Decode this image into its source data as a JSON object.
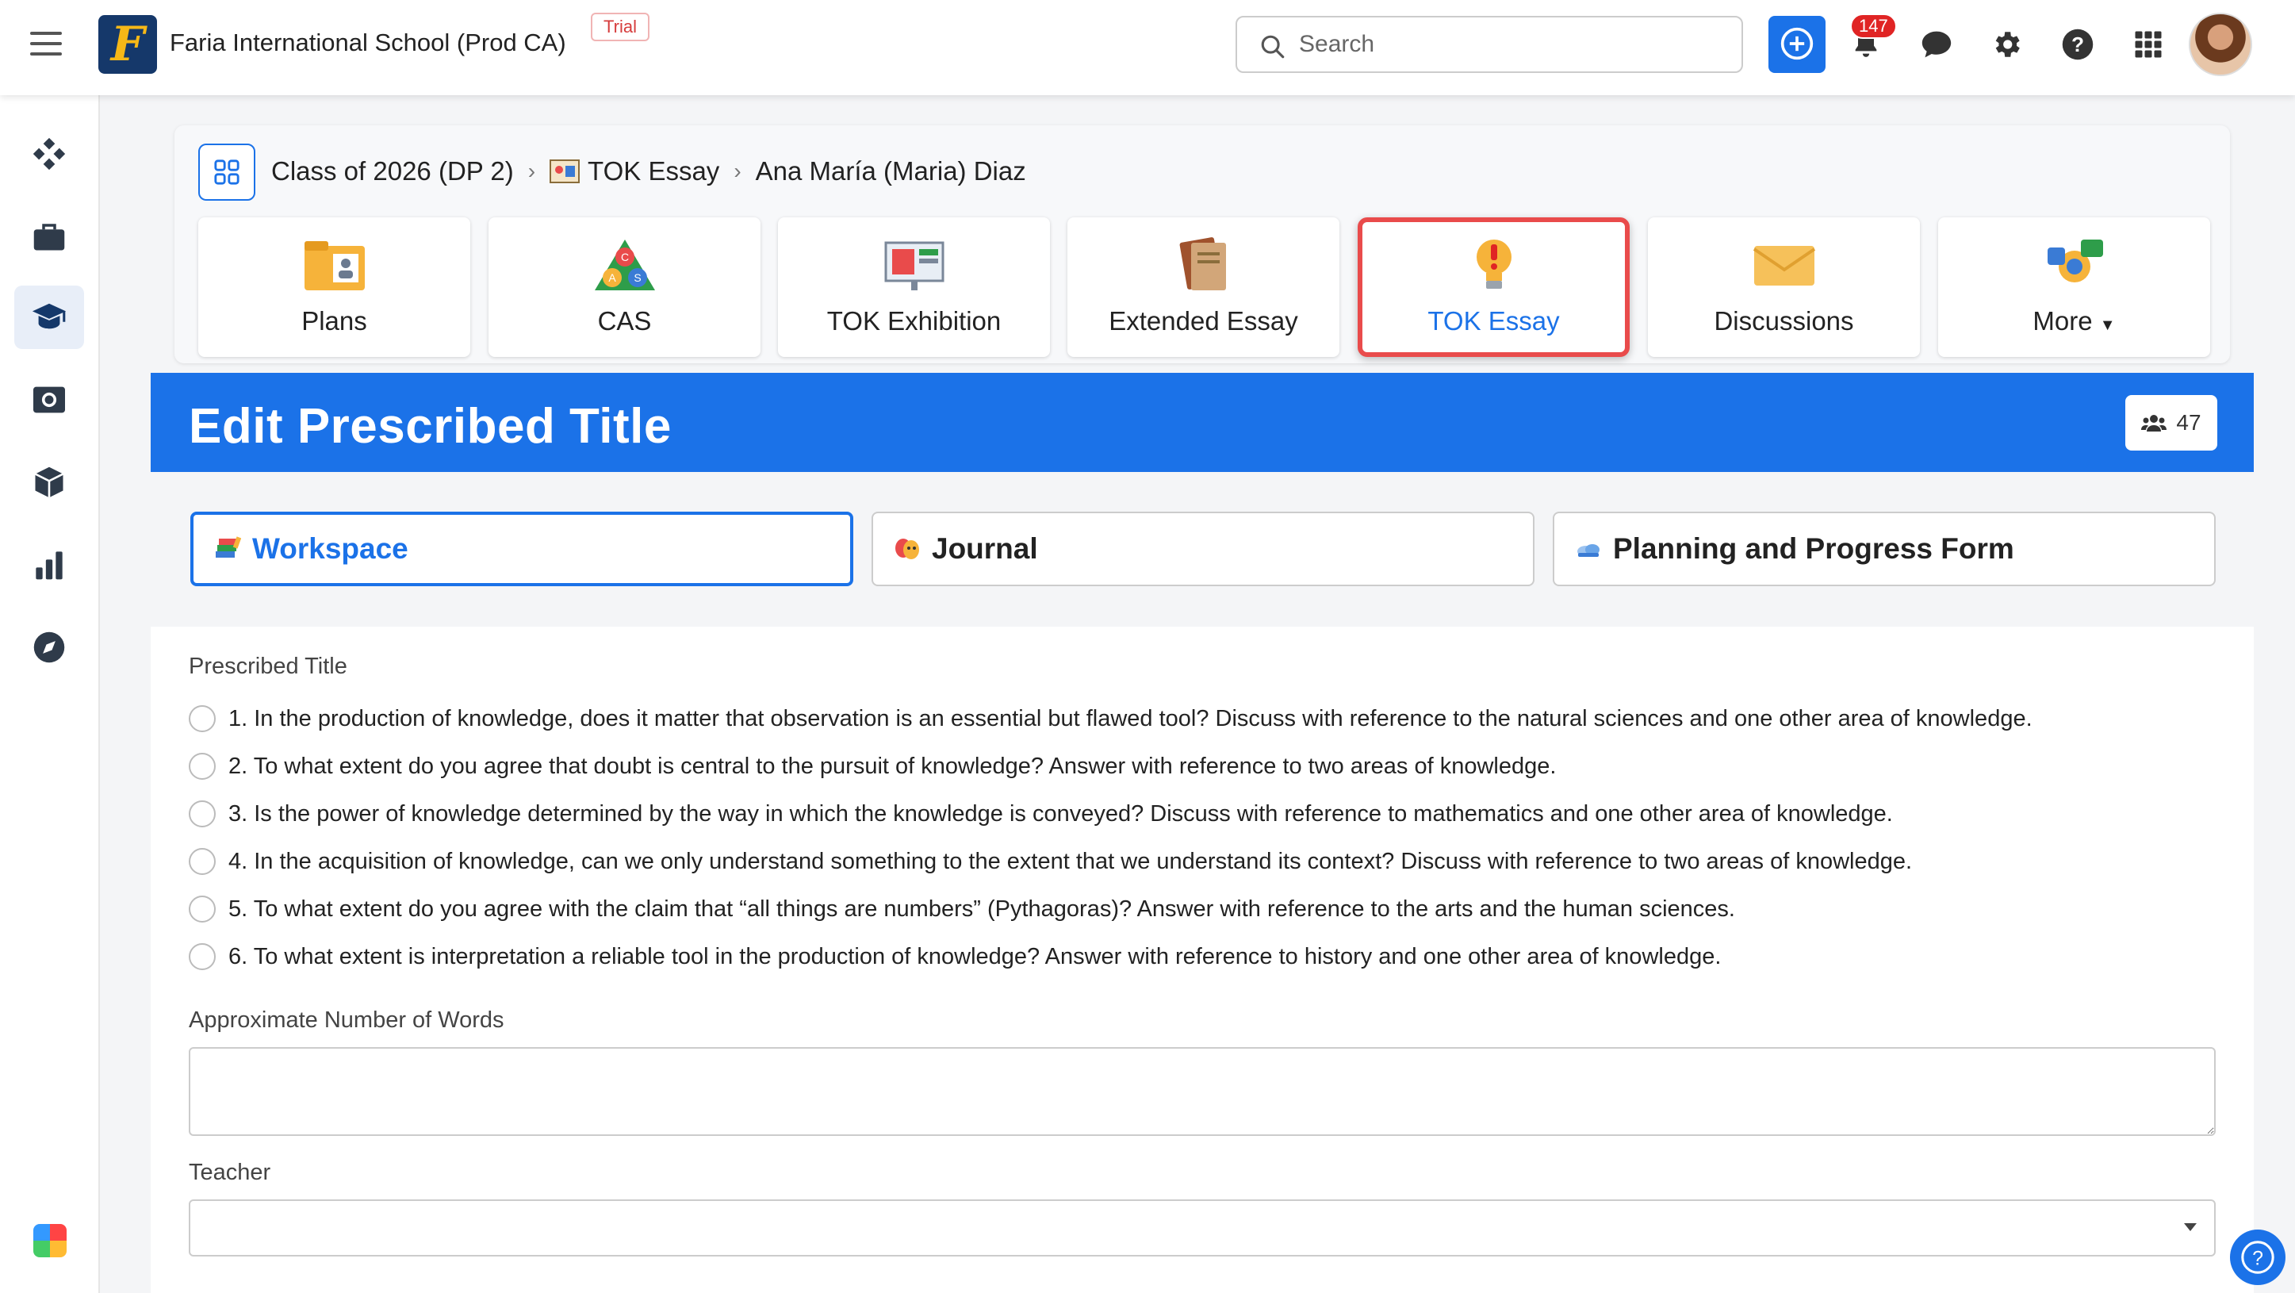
{
  "topbar": {
    "school_name": "Faria International School (Prod CA)",
    "trial_badge": "Trial",
    "search_placeholder": "Search",
    "notification_count": "147",
    "logo_letter": "F"
  },
  "breadcrumb": {
    "class_name": "Class of 2026 (DP 2)",
    "section": "TOK Essay",
    "student": "Ana María (Maria) Diaz"
  },
  "tiles": [
    {
      "label": "Plans",
      "icon": "folder-person-icon"
    },
    {
      "label": "CAS",
      "icon": "cas-triangle-icon"
    },
    {
      "label": "TOK Exhibition",
      "icon": "presentation-icon"
    },
    {
      "label": "Extended Essay",
      "icon": "books-icon"
    },
    {
      "label": "TOK Essay",
      "icon": "lightbulb-icon",
      "active": true
    },
    {
      "label": "Discussions",
      "icon": "envelope-icon"
    },
    {
      "label": "More",
      "icon": "more-icon"
    }
  ],
  "banner": {
    "title": "Edit Prescribed Title",
    "member_count": "47"
  },
  "workspace_tabs": [
    {
      "label": "Workspace",
      "active": true
    },
    {
      "label": "Journal"
    },
    {
      "label": "Planning and Progress Form"
    }
  ],
  "form": {
    "prescribed_title_label": "Prescribed Title",
    "options": [
      "1. In the production of knowledge, does it matter that observation is an essential but flawed tool? Discuss with reference to the natural sciences and one other area of knowledge.",
      "2. To what extent do you agree that doubt is central to the pursuit of knowledge? Answer with reference to two areas of knowledge.",
      "3. Is the power of knowledge determined by the way in which the knowledge is conveyed? Discuss with reference to mathematics and one other area of knowledge.",
      "4. In the acquisition of knowledge, can we only understand something to the extent that we understand its context? Discuss with reference to two areas of knowledge.",
      "5. To what extent do you agree with the claim that “all things are numbers” (Pythagoras)? Answer with reference to the arts and the human sciences.",
      "6. To what extent is interpretation a reliable tool in the production of knowledge? Answer with reference to history and one other area of knowledge."
    ],
    "words_label": "Approximate Number of Words",
    "words_value": "",
    "teacher_label": "Teacher",
    "teacher_value": ""
  },
  "colors": {
    "primary": "#1b72e8",
    "active_outline": "#e94b4b",
    "badge": "#e02424"
  }
}
